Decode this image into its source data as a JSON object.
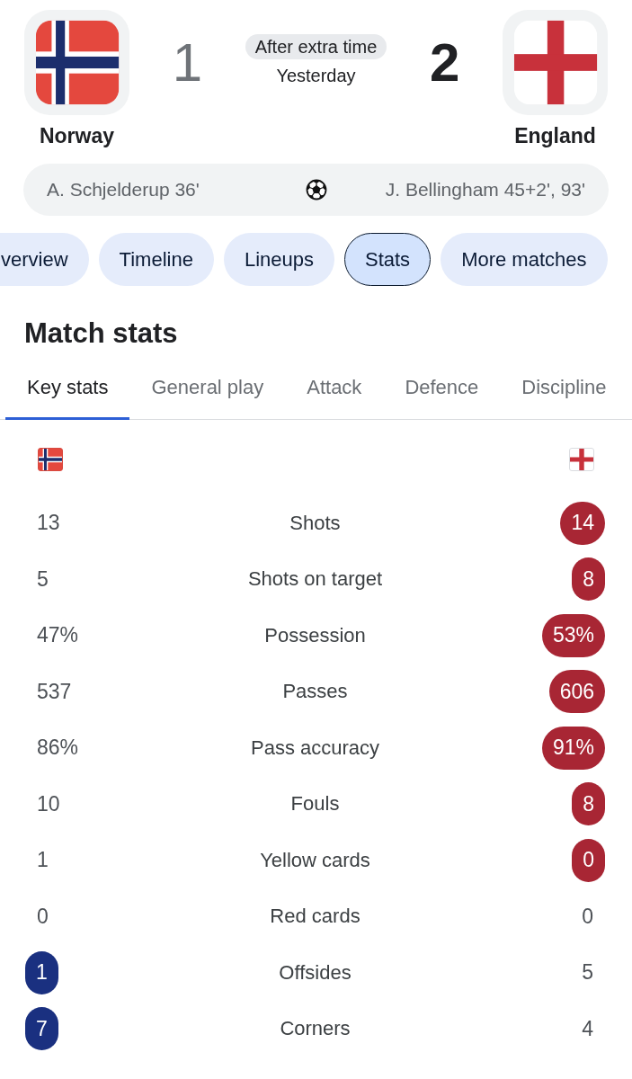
{
  "teams": [
    {
      "name": "Norway",
      "score": "1",
      "winner": false,
      "color": "#1a3080"
    },
    {
      "name": "England",
      "score": "2",
      "winner": true,
      "color": "#a82634"
    }
  ],
  "match": {
    "status": "After extra time",
    "date": "Yesterday"
  },
  "goals": {
    "home": "A. Schjelderup 36'",
    "away": "J. Bellingham 45+2', 93'"
  },
  "tabs": [
    {
      "label": "verview",
      "selected": false
    },
    {
      "label": "Timeline",
      "selected": false
    },
    {
      "label": "Lineups",
      "selected": false
    },
    {
      "label": "Stats",
      "selected": true
    },
    {
      "label": "More matches",
      "selected": false
    }
  ],
  "match_stats": {
    "title": "Match stats",
    "tabs": [
      {
        "label": "Key stats",
        "selected": true
      },
      {
        "label": "General play",
        "selected": false
      },
      {
        "label": "Attack",
        "selected": false
      },
      {
        "label": "Defence",
        "selected": false
      },
      {
        "label": "Discipline",
        "selected": false
      }
    ],
    "stats": [
      {
        "label": "Shots",
        "home": {
          "value": "13",
          "highlighted": false
        },
        "away": {
          "value": "14",
          "highlighted": true
        }
      },
      {
        "label": "Shots on target",
        "home": {
          "value": "5",
          "highlighted": false
        },
        "away": {
          "value": "8",
          "highlighted": true
        }
      },
      {
        "label": "Possession",
        "home": {
          "value": "47%",
          "highlighted": false
        },
        "away": {
          "value": "53%",
          "highlighted": true
        }
      },
      {
        "label": "Passes",
        "home": {
          "value": "537",
          "highlighted": false
        },
        "away": {
          "value": "606",
          "highlighted": true
        }
      },
      {
        "label": "Pass accuracy",
        "home": {
          "value": "86%",
          "highlighted": false
        },
        "away": {
          "value": "91%",
          "highlighted": true
        }
      },
      {
        "label": "Fouls",
        "home": {
          "value": "10",
          "highlighted": false
        },
        "away": {
          "value": "8",
          "highlighted": true
        }
      },
      {
        "label": "Yellow cards",
        "home": {
          "value": "1",
          "highlighted": false
        },
        "away": {
          "value": "0",
          "highlighted": true
        }
      },
      {
        "label": "Red cards",
        "home": {
          "value": "0",
          "highlighted": false
        },
        "away": {
          "value": "0",
          "highlighted": false
        }
      },
      {
        "label": "Offsides",
        "home": {
          "value": "1",
          "highlighted": true
        },
        "away": {
          "value": "5",
          "highlighted": false
        }
      },
      {
        "label": "Corners",
        "home": {
          "value": "7",
          "highlighted": true
        },
        "away": {
          "value": "4",
          "highlighted": false
        }
      }
    ]
  }
}
